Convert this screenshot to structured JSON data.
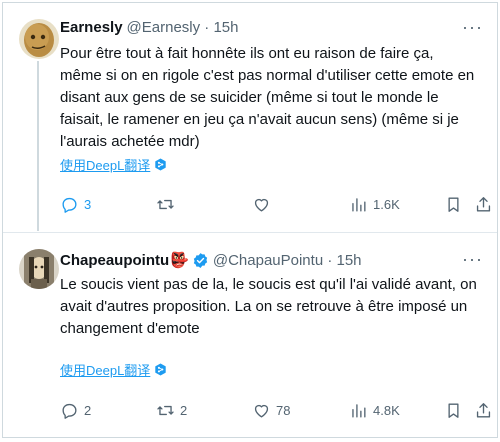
{
  "tweets": [
    {
      "name": "Earnesly",
      "meta": "@Earnesly · 15h",
      "text": "Pour être tout à fait honnête ils ont eu raison de faire ça, même si on en rigole c'est pas normal d'utiliser cette emote en disant aux gens de se suicider (même si tout le monde le faisait, le ramener en jeu ça n'avait aucun sens) (même si je l'aurais achetée mdr)",
      "translate": "使用DeepL翻译",
      "replies": "3",
      "retweets": "",
      "likes": "",
      "views": "1.6K"
    },
    {
      "name": "Chapeaupointu",
      "name_emoji": "👺",
      "meta": "@ChapauPointu · 15h",
      "text": "Le soucis vient pas de la, le soucis est qu'il l'ai validé avant, on avait d'autres proposition. La on se retrouve à être imposé un changement d'emote",
      "translate": "使用DeepL翻译",
      "replies": "2",
      "retweets": "2",
      "likes": "78",
      "views": "4.8K"
    }
  ],
  "icons": {
    "reply": "reply-icon",
    "retweet": "retweet-icon",
    "like": "heart-icon",
    "views": "views-icon",
    "bookmark": "bookmark-icon",
    "share": "share-icon",
    "more": "more-icon",
    "verified": "verified-badge-icon",
    "deepl": "deepl-icon"
  },
  "colors": {
    "accent": "#1d9bf0",
    "text": "#0f1419",
    "secondary": "#536471",
    "border": "#cfd9de"
  }
}
